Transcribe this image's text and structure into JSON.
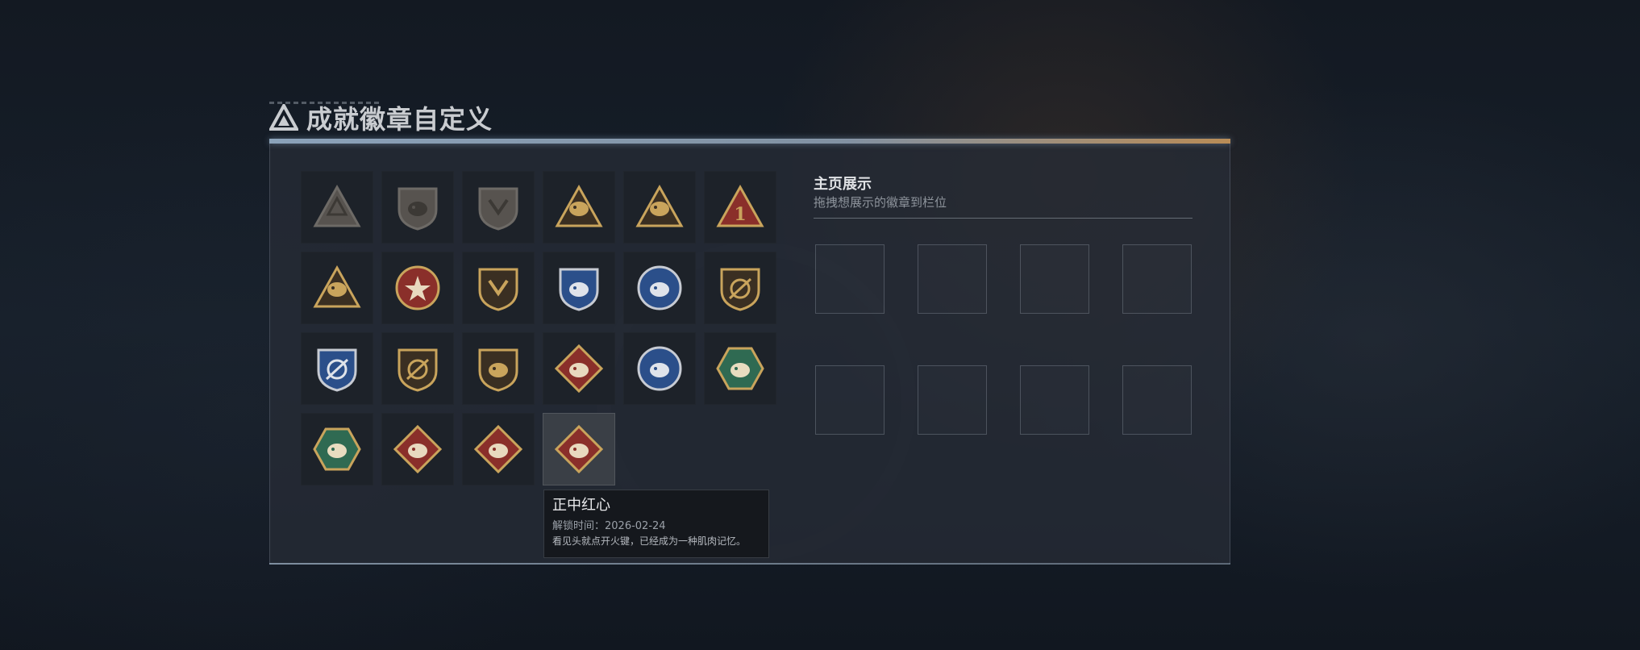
{
  "header": {
    "title": "成就徽章自定义"
  },
  "badges": [
    {
      "icon": "gray-shield-triangle-badge"
    },
    {
      "icon": "gray-helicopter-badge"
    },
    {
      "icon": "gray-shield-arrow-badge"
    },
    {
      "icon": "gold-triangle-hourglass-badge"
    },
    {
      "icon": "gold-triangle-boat-badge"
    },
    {
      "icon": "red-triangle-number-one-badge"
    },
    {
      "icon": "gold-triangle-figures-badge"
    },
    {
      "icon": "red-star-medal-badge"
    },
    {
      "icon": "gold-shield-chevron-badge"
    },
    {
      "icon": "blue-eagle-shield-badge"
    },
    {
      "icon": "blue-skull-medal-badge"
    },
    {
      "icon": "gold-crosshair-shield-badge"
    },
    {
      "icon": "blue-crosshair-shield-badge"
    },
    {
      "icon": "gold-scope-shield-badge"
    },
    {
      "icon": "gold-rifle-shield-badge"
    },
    {
      "icon": "red-diamond-wolf-badge"
    },
    {
      "icon": "blue-circle-eagle-badge"
    },
    {
      "icon": "green-hexagon-wasp-badge"
    },
    {
      "icon": "green-hexagon-gun-badge"
    },
    {
      "icon": "red-diamond-dragon-badge"
    },
    {
      "icon": "red-diamond-runner-badge"
    },
    {
      "icon": "red-diamond-crocodile-badge"
    }
  ],
  "showcase": {
    "title": "主页展示",
    "subtitle": "拖拽想展示的徽章到栏位",
    "slot_count": 8
  },
  "tooltip": {
    "name": "正中红心",
    "unlock_label": "解锁时间：",
    "unlock_date": "2026-02-24",
    "description": "看见头就点开火键，已经成为一种肌肉记忆。"
  },
  "colors": {
    "gold": "#c9a45c",
    "red": "#8a2f2a",
    "blue": "#2b4f8a",
    "green": "#2f6a52",
    "gray": "#6d6a66"
  }
}
